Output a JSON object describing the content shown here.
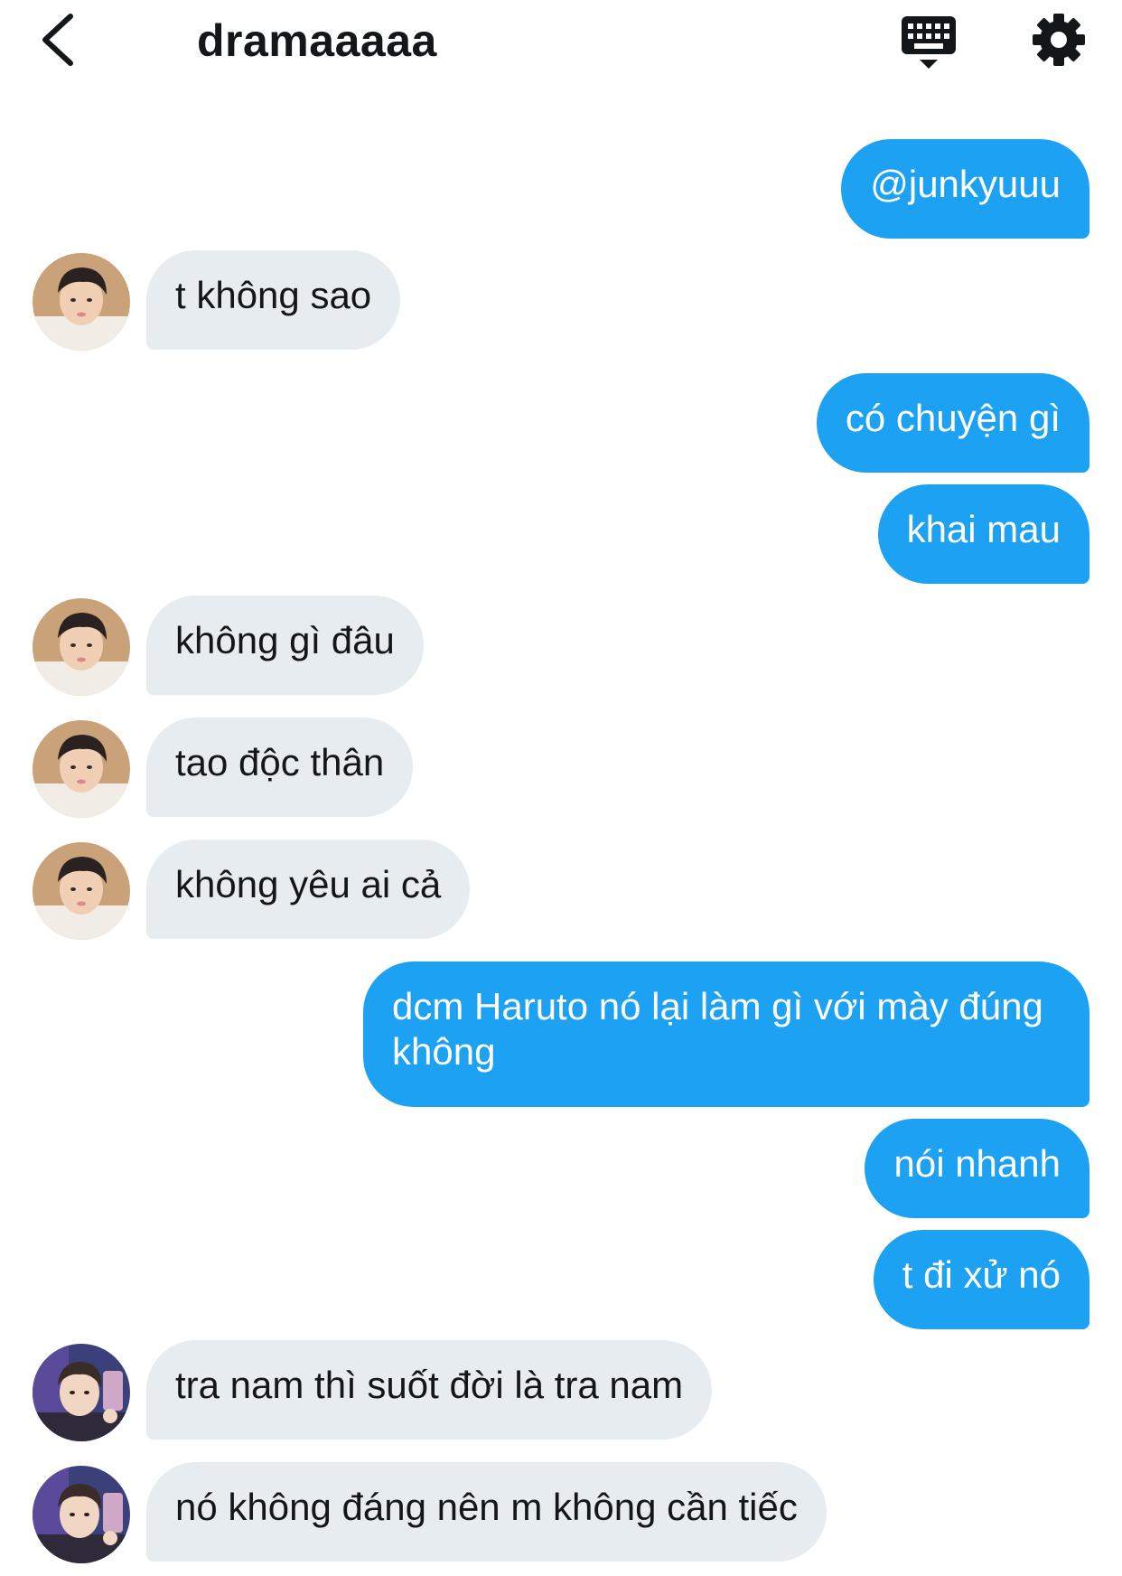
{
  "header": {
    "title": "dramaaaaa",
    "back_icon": "chevron-left-icon",
    "keyboard_icon": "keyboard-icon",
    "settings_icon": "gear-icon"
  },
  "colors": {
    "outgoing_bubble": "#1da1f2",
    "incoming_bubble": "#e6ecf0",
    "text_dark": "#14171a"
  },
  "messages": [
    {
      "dir": "out",
      "text": "@junkyuuu"
    },
    {
      "dir": "in",
      "text": "t không sao",
      "avatar": "avatar-a"
    },
    {
      "dir": "out",
      "text": "có chuyện gì"
    },
    {
      "dir": "out",
      "text": "khai mau"
    },
    {
      "dir": "in",
      "text": "không gì đâu",
      "avatar": "avatar-a"
    },
    {
      "dir": "in",
      "text": "tao độc thân",
      "avatar": "avatar-a"
    },
    {
      "dir": "in",
      "text": "không yêu ai cả",
      "avatar": "avatar-a"
    },
    {
      "dir": "out",
      "text": "dcm Haruto nó lại làm gì với mày đúng không"
    },
    {
      "dir": "out",
      "text": "nói nhanh"
    },
    {
      "dir": "out",
      "text": "t đi xử nó"
    },
    {
      "dir": "in",
      "text": "tra nam thì suốt đời là tra nam",
      "avatar": "avatar-b"
    },
    {
      "dir": "in",
      "text": "nó không đáng nên m không cần tiếc",
      "avatar": "avatar-b"
    }
  ]
}
